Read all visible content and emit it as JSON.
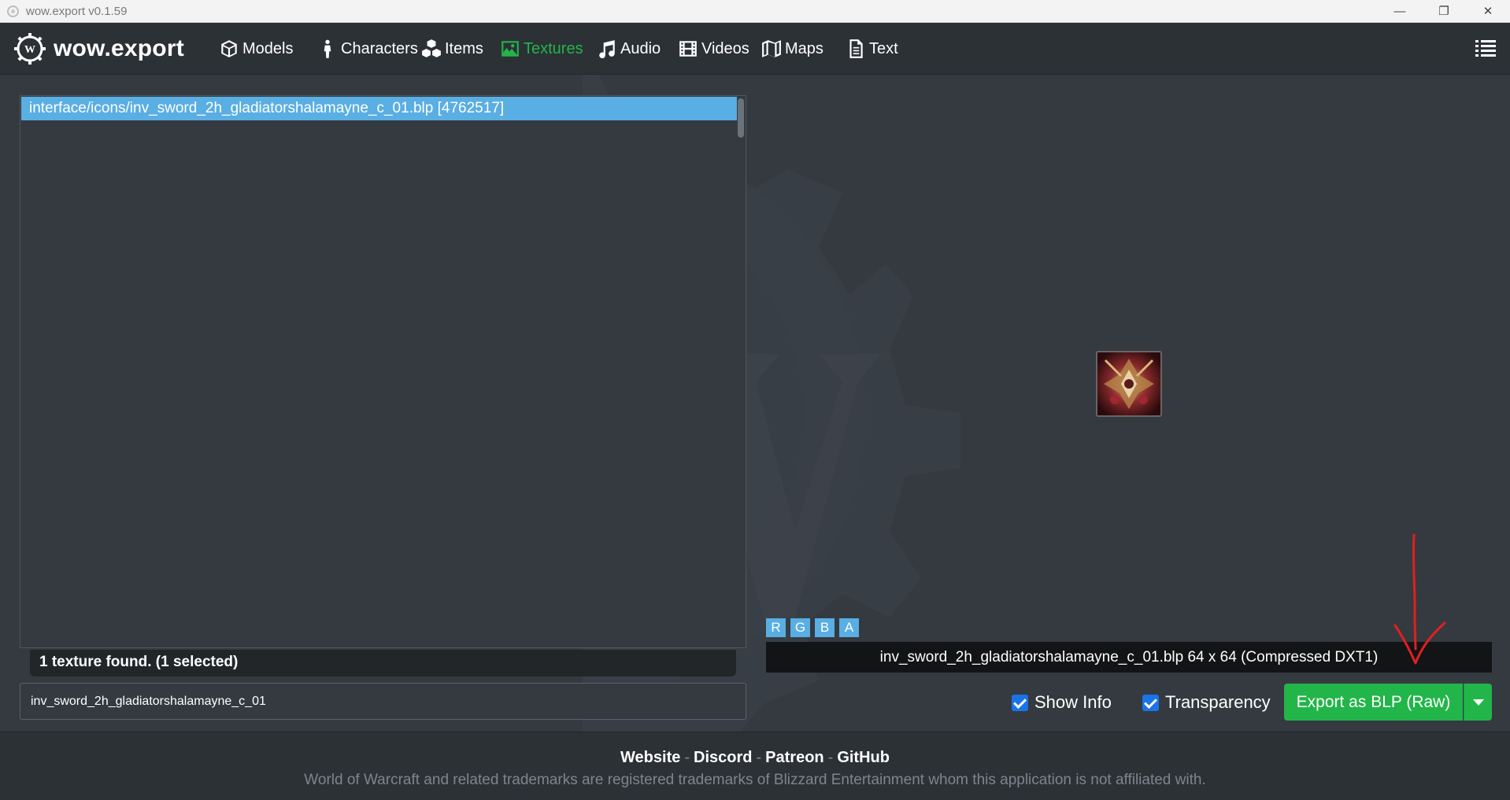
{
  "window": {
    "title": "wow.export v0.1.59",
    "minimize": "—",
    "restore": "❐",
    "close": "✕"
  },
  "nav": {
    "logo_text": "wow.export",
    "items": [
      {
        "label": "Models",
        "icon": "cube-icon"
      },
      {
        "label": "Characters",
        "icon": "person-icon"
      },
      {
        "label": "Items",
        "icon": "cubes-icon"
      },
      {
        "label": "Textures",
        "icon": "image-icon",
        "active": true
      },
      {
        "label": "Audio",
        "icon": "music-icon"
      },
      {
        "label": "Videos",
        "icon": "film-icon"
      },
      {
        "label": "Maps",
        "icon": "map-icon"
      },
      {
        "label": "Text",
        "icon": "file-text-icon"
      }
    ],
    "active_color": "#22b549"
  },
  "file_list": {
    "items": [
      {
        "label": "interface/icons/inv_sword_2h_gladiatorshalamayne_c_01.blp [4762517]",
        "selected": true
      }
    ],
    "status": "1 texture found. (1 selected)"
  },
  "filter": {
    "value": "inv_sword_2h_gladiatorshalamayne_c_01"
  },
  "preview": {
    "channels": [
      "R",
      "G",
      "B",
      "A"
    ],
    "info": "inv_sword_2h_gladiatorshalamayne_c_01.blp 64 x 64 (Compressed DXT1)",
    "show_info_label": "Show Info",
    "show_info_checked": true,
    "transparency_label": "Transparency",
    "transparency_checked": true,
    "export_label": "Export as BLP (Raw)"
  },
  "footer": {
    "links": [
      "Website",
      "Discord",
      "Patreon",
      "GitHub"
    ],
    "separator": "-",
    "copyright": "World of Warcraft and related trademarks are registered trademarks of Blizzard Entertainment whom this application is not affiliated with."
  },
  "colors": {
    "accent": "#22b549",
    "selection": "#59aee3",
    "annotation": "#e02020"
  }
}
